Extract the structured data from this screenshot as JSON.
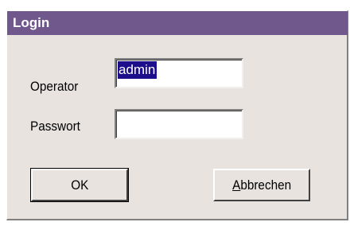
{
  "window": {
    "title": "Login"
  },
  "form": {
    "operator_label": "Operator",
    "operator_value": "admin",
    "password_label": "Passwort",
    "password_value": ""
  },
  "buttons": {
    "ok_label": "OK",
    "cancel_mnemonic": "A",
    "cancel_rest": "bbrechen"
  },
  "colors": {
    "titlebar": "#70588c",
    "dialog_bg": "#e9e3e0",
    "selection": "#1d0e8c"
  }
}
